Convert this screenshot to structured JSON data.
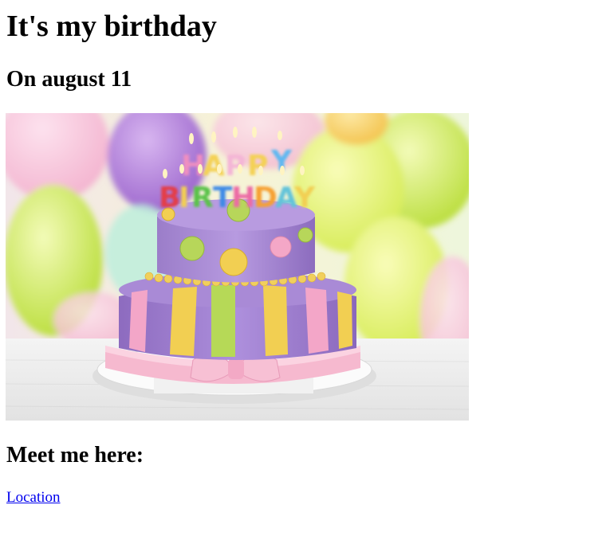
{
  "page": {
    "title": "It's my birthday",
    "date_heading": "On august 11",
    "meet_heading": "Meet me here:",
    "location_link": "Location"
  },
  "image": {
    "description_icon": "birthday-cake-photo",
    "cake_topper_top": "HAPPY",
    "cake_topper_bottom": "BIRTHDAY"
  },
  "colors": {
    "link": "#0000ee",
    "text": "#000000",
    "background": "#ffffff"
  }
}
